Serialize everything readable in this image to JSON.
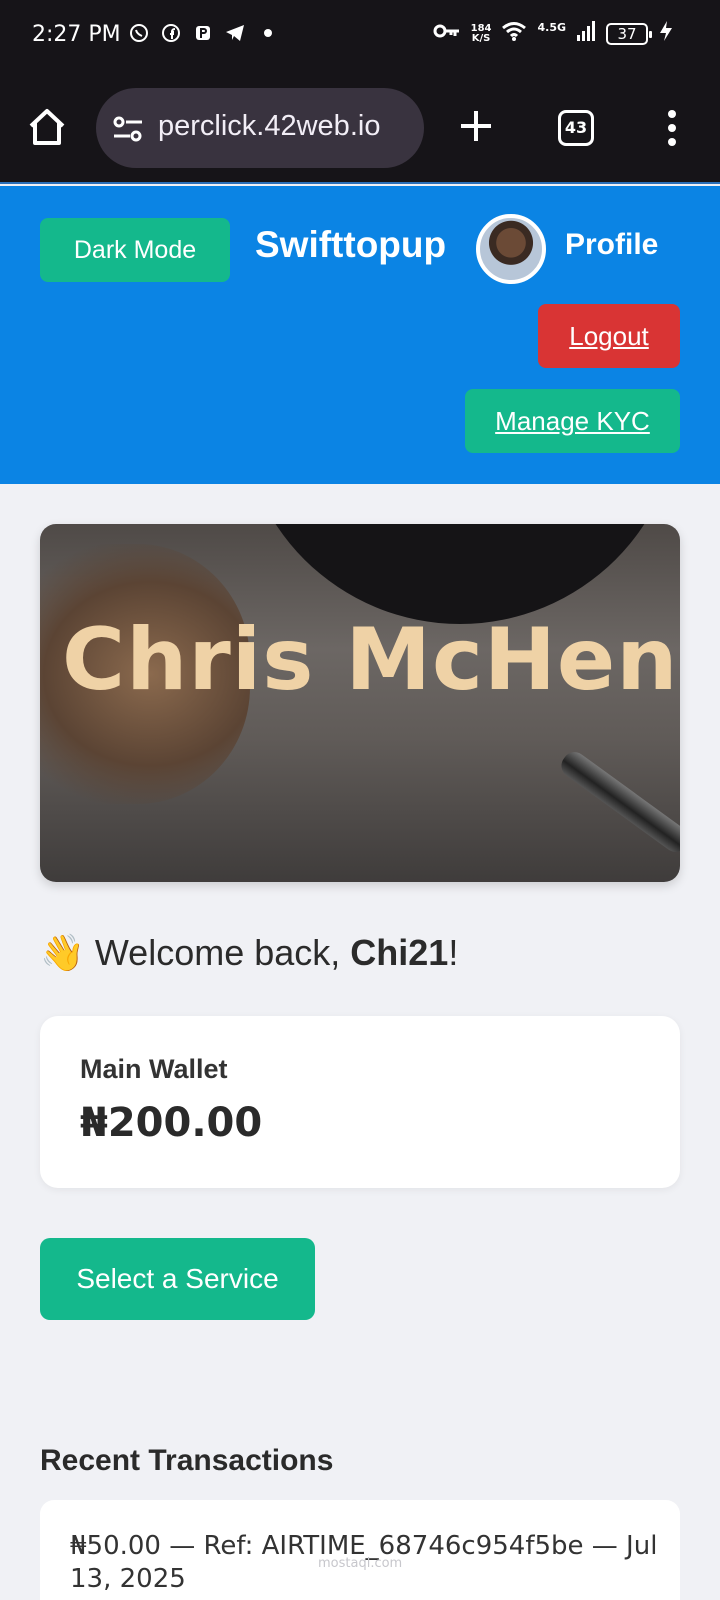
{
  "status_bar": {
    "time": "2:27 PM",
    "speed_value": "184",
    "speed_unit": "K/S",
    "network": "4.5G",
    "battery": "37",
    "left_icons": [
      "whatsapp-icon",
      "facebook-icon",
      "paypal-icon",
      "telegram-icon"
    ],
    "right_icons": [
      "key-icon",
      "wifi-icon",
      "signal-icon",
      "charging-icon"
    ]
  },
  "browser": {
    "url": "perclick.42web.io",
    "tab_count": "43"
  },
  "header": {
    "dark_mode_label": "Dark Mode",
    "brand": "Swifttopup",
    "profile_label": "Profile",
    "logout_label": "Logout",
    "kyc_label": "Manage KYC"
  },
  "banner": {
    "text": "Chris McHenry"
  },
  "welcome": {
    "emoji": "👋",
    "prefix": "Welcome back, ",
    "username": "Chi21",
    "suffix": "!"
  },
  "wallet": {
    "label": "Main Wallet",
    "amount": "₦200.00"
  },
  "service_button": "Select a Service",
  "recent": {
    "title": "Recent Transactions",
    "items": [
      {
        "text": "₦50.00 — Ref: AIRTIME_68746c954f5be — Jul 13, 2025"
      }
    ]
  },
  "watermark": "mostaql.com",
  "colors": {
    "header_blue": "#0b84e4",
    "accent_green": "#14b88c",
    "logout_red": "#d93434",
    "page_bg": "#f0f1f5"
  }
}
